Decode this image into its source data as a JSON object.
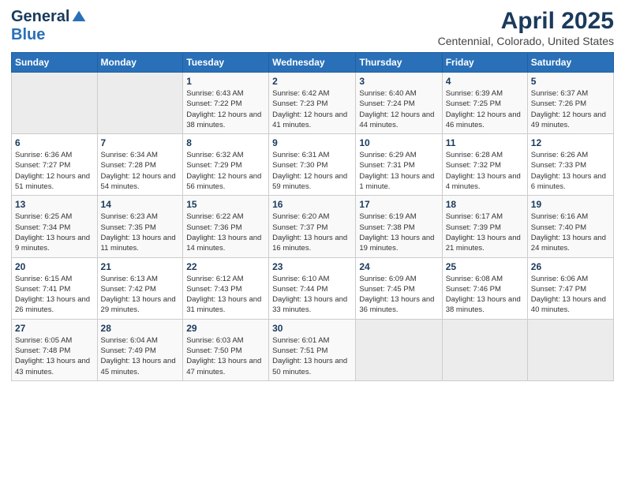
{
  "header": {
    "logo_general": "General",
    "logo_blue": "Blue",
    "title": "April 2025",
    "subtitle": "Centennial, Colorado, United States"
  },
  "weekdays": [
    "Sunday",
    "Monday",
    "Tuesday",
    "Wednesday",
    "Thursday",
    "Friday",
    "Saturday"
  ],
  "weeks": [
    [
      {
        "day": "",
        "info": ""
      },
      {
        "day": "",
        "info": ""
      },
      {
        "day": "1",
        "info": "Sunrise: 6:43 AM\nSunset: 7:22 PM\nDaylight: 12 hours and 38 minutes."
      },
      {
        "day": "2",
        "info": "Sunrise: 6:42 AM\nSunset: 7:23 PM\nDaylight: 12 hours and 41 minutes."
      },
      {
        "day": "3",
        "info": "Sunrise: 6:40 AM\nSunset: 7:24 PM\nDaylight: 12 hours and 44 minutes."
      },
      {
        "day": "4",
        "info": "Sunrise: 6:39 AM\nSunset: 7:25 PM\nDaylight: 12 hours and 46 minutes."
      },
      {
        "day": "5",
        "info": "Sunrise: 6:37 AM\nSunset: 7:26 PM\nDaylight: 12 hours and 49 minutes."
      }
    ],
    [
      {
        "day": "6",
        "info": "Sunrise: 6:36 AM\nSunset: 7:27 PM\nDaylight: 12 hours and 51 minutes."
      },
      {
        "day": "7",
        "info": "Sunrise: 6:34 AM\nSunset: 7:28 PM\nDaylight: 12 hours and 54 minutes."
      },
      {
        "day": "8",
        "info": "Sunrise: 6:32 AM\nSunset: 7:29 PM\nDaylight: 12 hours and 56 minutes."
      },
      {
        "day": "9",
        "info": "Sunrise: 6:31 AM\nSunset: 7:30 PM\nDaylight: 12 hours and 59 minutes."
      },
      {
        "day": "10",
        "info": "Sunrise: 6:29 AM\nSunset: 7:31 PM\nDaylight: 13 hours and 1 minute."
      },
      {
        "day": "11",
        "info": "Sunrise: 6:28 AM\nSunset: 7:32 PM\nDaylight: 13 hours and 4 minutes."
      },
      {
        "day": "12",
        "info": "Sunrise: 6:26 AM\nSunset: 7:33 PM\nDaylight: 13 hours and 6 minutes."
      }
    ],
    [
      {
        "day": "13",
        "info": "Sunrise: 6:25 AM\nSunset: 7:34 PM\nDaylight: 13 hours and 9 minutes."
      },
      {
        "day": "14",
        "info": "Sunrise: 6:23 AM\nSunset: 7:35 PM\nDaylight: 13 hours and 11 minutes."
      },
      {
        "day": "15",
        "info": "Sunrise: 6:22 AM\nSunset: 7:36 PM\nDaylight: 13 hours and 14 minutes."
      },
      {
        "day": "16",
        "info": "Sunrise: 6:20 AM\nSunset: 7:37 PM\nDaylight: 13 hours and 16 minutes."
      },
      {
        "day": "17",
        "info": "Sunrise: 6:19 AM\nSunset: 7:38 PM\nDaylight: 13 hours and 19 minutes."
      },
      {
        "day": "18",
        "info": "Sunrise: 6:17 AM\nSunset: 7:39 PM\nDaylight: 13 hours and 21 minutes."
      },
      {
        "day": "19",
        "info": "Sunrise: 6:16 AM\nSunset: 7:40 PM\nDaylight: 13 hours and 24 minutes."
      }
    ],
    [
      {
        "day": "20",
        "info": "Sunrise: 6:15 AM\nSunset: 7:41 PM\nDaylight: 13 hours and 26 minutes."
      },
      {
        "day": "21",
        "info": "Sunrise: 6:13 AM\nSunset: 7:42 PM\nDaylight: 13 hours and 29 minutes."
      },
      {
        "day": "22",
        "info": "Sunrise: 6:12 AM\nSunset: 7:43 PM\nDaylight: 13 hours and 31 minutes."
      },
      {
        "day": "23",
        "info": "Sunrise: 6:10 AM\nSunset: 7:44 PM\nDaylight: 13 hours and 33 minutes."
      },
      {
        "day": "24",
        "info": "Sunrise: 6:09 AM\nSunset: 7:45 PM\nDaylight: 13 hours and 36 minutes."
      },
      {
        "day": "25",
        "info": "Sunrise: 6:08 AM\nSunset: 7:46 PM\nDaylight: 13 hours and 38 minutes."
      },
      {
        "day": "26",
        "info": "Sunrise: 6:06 AM\nSunset: 7:47 PM\nDaylight: 13 hours and 40 minutes."
      }
    ],
    [
      {
        "day": "27",
        "info": "Sunrise: 6:05 AM\nSunset: 7:48 PM\nDaylight: 13 hours and 43 minutes."
      },
      {
        "day": "28",
        "info": "Sunrise: 6:04 AM\nSunset: 7:49 PM\nDaylight: 13 hours and 45 minutes."
      },
      {
        "day": "29",
        "info": "Sunrise: 6:03 AM\nSunset: 7:50 PM\nDaylight: 13 hours and 47 minutes."
      },
      {
        "day": "30",
        "info": "Sunrise: 6:01 AM\nSunset: 7:51 PM\nDaylight: 13 hours and 50 minutes."
      },
      {
        "day": "",
        "info": ""
      },
      {
        "day": "",
        "info": ""
      },
      {
        "day": "",
        "info": ""
      }
    ]
  ]
}
